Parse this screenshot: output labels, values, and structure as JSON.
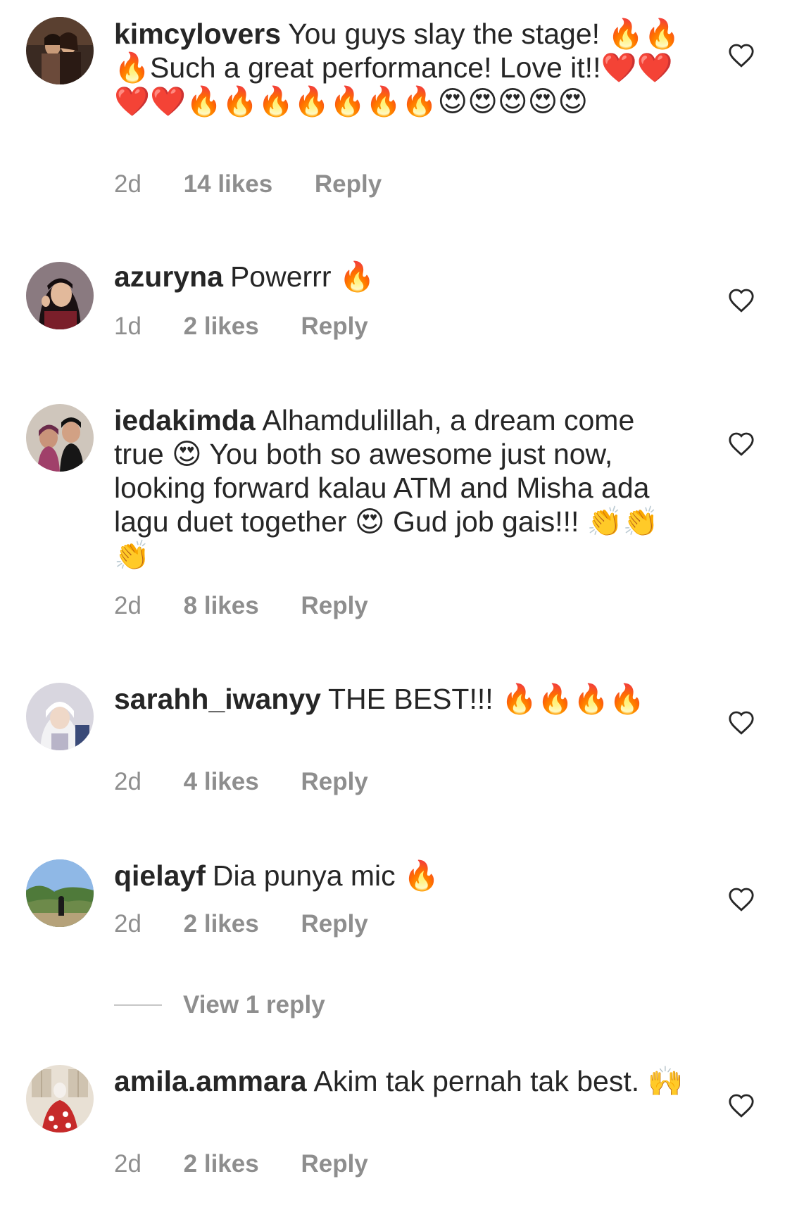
{
  "colors": {
    "text": "#262626",
    "meta": "#8e8e8e",
    "divider": "#c7c7c7",
    "background": "#ffffff"
  },
  "comments": [
    {
      "username": "kimcylovers",
      "text": "You guys slay the stage! 🔥🔥🔥Such a great performance! Love it!!❤️❤️❤️❤️🔥🔥🔥🔥🔥🔥🔥😍😍😍😍😍",
      "time": "2d",
      "likes": "14 likes",
      "reply": "Reply",
      "heart_icon": "heart-outline-icon"
    },
    {
      "username": "azuryna",
      "text": "Powerrr 🔥",
      "time": "1d",
      "likes": "2 likes",
      "reply": "Reply",
      "heart_icon": "heart-outline-icon"
    },
    {
      "username": "iedakimda",
      "text": "Alhamdulillah, a dream come true 😍 You both so awesome just now, looking forward kalau ATM and Misha ada lagu duet together 😍 Gud job gais!!! 👏👏👏",
      "time": "2d",
      "likes": "8 likes",
      "reply": "Reply",
      "heart_icon": "heart-outline-icon"
    },
    {
      "username": "sarahh_iwanyy",
      "text": "THE BEST!!! 🔥🔥🔥🔥",
      "time": "2d",
      "likes": "4 likes",
      "reply": "Reply",
      "heart_icon": "heart-outline-icon"
    },
    {
      "username": "qielayf",
      "text": "Dia punya mic 🔥",
      "time": "2d",
      "likes": "2 likes",
      "reply": "Reply",
      "heart_icon": "heart-outline-icon"
    },
    {
      "username": "amila.ammara",
      "text": "Akim tak pernah tak best. 🙌",
      "time": "2d",
      "likes": "2 likes",
      "reply": "Reply",
      "heart_icon": "heart-outline-icon"
    }
  ],
  "view_replies": {
    "label": "View 1 reply"
  }
}
